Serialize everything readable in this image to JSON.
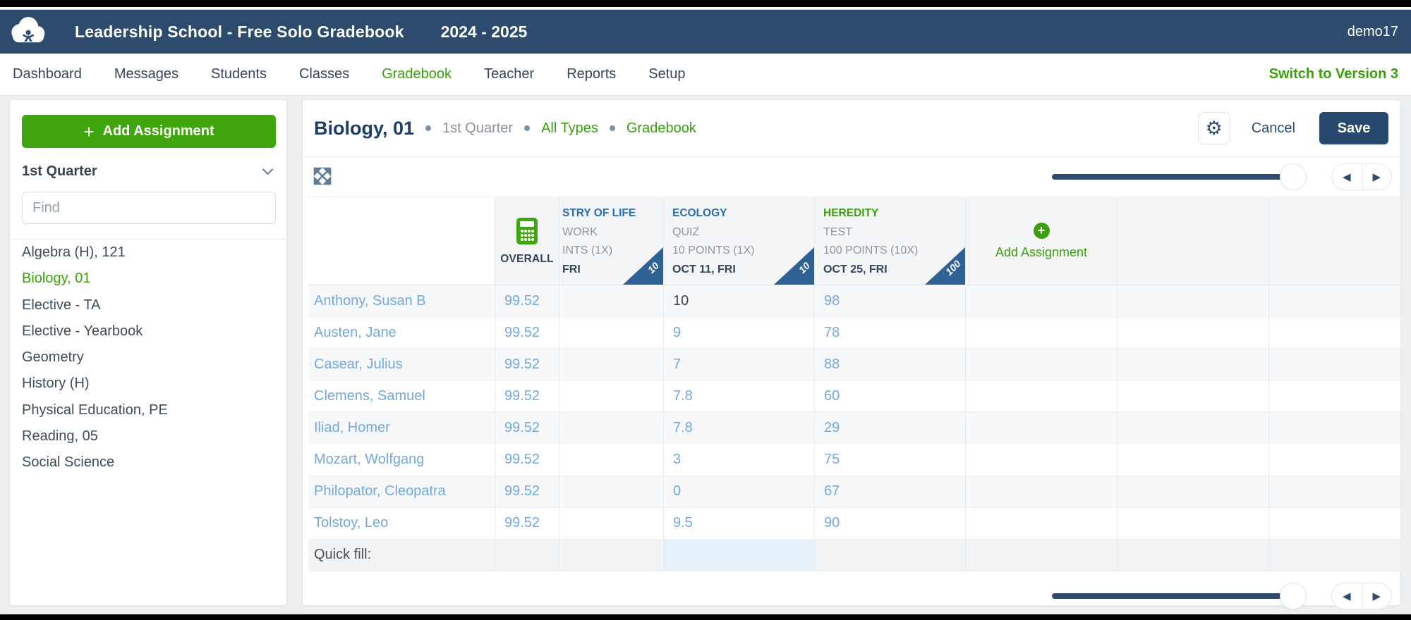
{
  "colors": {
    "topbar_blue": "#2d4b6d",
    "accent_green": "#3aa00c",
    "button_green": "#3fa60d",
    "save_navy": "#27496d",
    "link_blue": "#2a6db3",
    "value_blue": "#73a9dd",
    "badge_triangle_blue": "#2f6294"
  },
  "topbar": {
    "title": "Leadership School - Free Solo Gradebook",
    "year": "2024 - 2025",
    "user": "demo17"
  },
  "nav": {
    "items": [
      {
        "label": "Dashboard",
        "active": false
      },
      {
        "label": "Messages",
        "active": false
      },
      {
        "label": "Students",
        "active": false
      },
      {
        "label": "Classes",
        "active": false
      },
      {
        "label": "Gradebook",
        "active": true
      },
      {
        "label": "Teacher",
        "active": false
      },
      {
        "label": "Reports",
        "active": false
      },
      {
        "label": "Setup",
        "active": false
      }
    ],
    "switch_label": "Switch to Version 3"
  },
  "sidebar": {
    "add_button_plus": "+",
    "add_button_label": "Add Assignment",
    "quarter": "1st Quarter",
    "find_placeholder": "Find",
    "classes": [
      {
        "label": "Algebra (H), 121",
        "active": false
      },
      {
        "label": "Biology, 01",
        "active": true
      },
      {
        "label": "Elective - TA",
        "active": false
      },
      {
        "label": "Elective - Yearbook",
        "active": false
      },
      {
        "label": "Geometry",
        "active": false
      },
      {
        "label": "History (H)",
        "active": false
      },
      {
        "label": "Physical Education, PE",
        "active": false
      },
      {
        "label": "Reading, 05",
        "active": false
      },
      {
        "label": "Social Science",
        "active": false
      }
    ]
  },
  "main": {
    "title": "Biology, 01",
    "crumbs": [
      {
        "label": "1st Quarter",
        "color": "gray"
      },
      {
        "label": "All Types",
        "color": "green"
      },
      {
        "label": "Gradebook",
        "color": "green"
      }
    ],
    "cancel_label": "Cancel",
    "save_label": "Save",
    "table": {
      "overall_label": "OVERALL",
      "columns": [
        {
          "title": "STRY OF LIFE",
          "type": "WORK",
          "points": "INTS (1X)",
          "date": "FRI",
          "badge": "10",
          "title_color": "blue",
          "clipped": true
        },
        {
          "title": "ECOLOGY",
          "type": "QUIZ",
          "points": "10 POINTS (1X)",
          "date": "OCT 11, FRI",
          "badge": "10",
          "title_color": "blue",
          "clipped": false
        },
        {
          "title": "HEREDITY",
          "type": "TEST",
          "points": "100 POINTS (10X)",
          "date": "OCT 25, FRI",
          "badge": "100",
          "title_color": "green",
          "clipped": false
        }
      ],
      "add_assignment_plus": "+",
      "add_assignment_label": "Add Assignment",
      "rows": [
        {
          "name": "Anthony, Susan B",
          "overall": "99.52",
          "a1": "",
          "ecology": "10",
          "heredity": "98",
          "ecology_entered": true
        },
        {
          "name": "Austen, Jane",
          "overall": "99.52",
          "a1": "",
          "ecology": "9",
          "heredity": "78",
          "ecology_entered": false
        },
        {
          "name": "Casear, Julius",
          "overall": "99.52",
          "a1": "",
          "ecology": "7",
          "heredity": "88",
          "ecology_entered": false
        },
        {
          "name": "Clemens, Samuel",
          "overall": "99.52",
          "a1": "",
          "ecology": "7.8",
          "heredity": "60",
          "ecology_entered": false
        },
        {
          "name": "Iliad, Homer",
          "overall": "99.52",
          "a1": "",
          "ecology": "7.8",
          "heredity": "29",
          "ecology_entered": false
        },
        {
          "name": "Mozart, Wolfgang",
          "overall": "99.52",
          "a1": "",
          "ecology": "3",
          "heredity": "75",
          "ecology_entered": false
        },
        {
          "name": "Philopator, Cleopatra",
          "overall": "99.52",
          "a1": "",
          "ecology": "0",
          "heredity": "67",
          "ecology_entered": false
        },
        {
          "name": "Tolstoy, Leo",
          "overall": "99.52",
          "a1": "",
          "ecology": "9.5",
          "heredity": "90",
          "ecology_entered": false
        }
      ],
      "quick_fill_label": "Quick fill:"
    }
  }
}
